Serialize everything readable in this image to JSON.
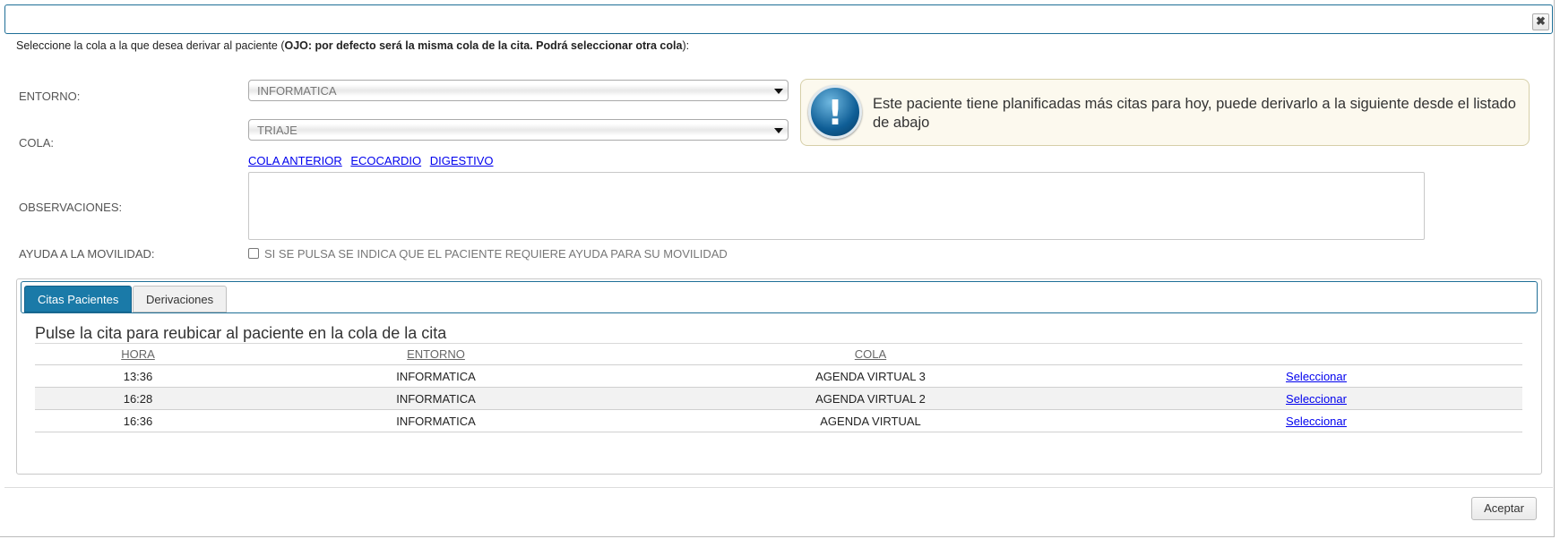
{
  "dialog": {
    "close_symbol": "✖",
    "intro_prefix": "Seleccione la cola a la que desea derivar al paciente (",
    "intro_bold": "OJO: por defecto será la misma cola de la cita. Podrá seleccionar otra cola",
    "intro_suffix": "):"
  },
  "form": {
    "entorno_label": "ENTORNO:",
    "entorno_value": "INFORMATICA",
    "cola_label": "COLA:",
    "cola_value": "TRIAJE",
    "quick_links": [
      "COLA ANTERIOR",
      "ECOCARDIO",
      "DIGESTIVO"
    ],
    "observaciones_label": "OBSERVACIONES:",
    "movilidad_label": "AYUDA A LA MOVILIDAD:",
    "movilidad_checkbox_text": "SI SE PULSA SE INDICA QUE EL PACIENTE REQUIERE AYUDA PARA SU MOVILIDAD"
  },
  "info": {
    "icon": "exclamation-info-icon",
    "message": "Este paciente tiene planificadas más citas para hoy, puede derivarlo a la siguiente desde el listado de abajo"
  },
  "tabs": [
    {
      "label": "Citas Pacientes",
      "active": true
    },
    {
      "label": "Derivaciones",
      "active": false
    }
  ],
  "table": {
    "title": "Pulse la cita para reubicar al paciente en la cola de la cita",
    "headers": [
      "HORA",
      "ENTORNO",
      "COLA",
      ""
    ],
    "rows": [
      {
        "hora": "13:36",
        "entorno": "INFORMATICA",
        "cola": "AGENDA VIRTUAL 3",
        "action": "Seleccionar"
      },
      {
        "hora": "16:28",
        "entorno": "INFORMATICA",
        "cola": "AGENDA VIRTUAL 2",
        "action": "Seleccionar"
      },
      {
        "hora": "16:36",
        "entorno": "INFORMATICA",
        "cola": "AGENDA VIRTUAL",
        "action": "Seleccionar"
      }
    ]
  },
  "footer": {
    "accept_label": "Aceptar"
  },
  "colors": {
    "accent": "#1a7aa8",
    "link": "#0000ee",
    "info_bg": "#fcf9ee"
  }
}
